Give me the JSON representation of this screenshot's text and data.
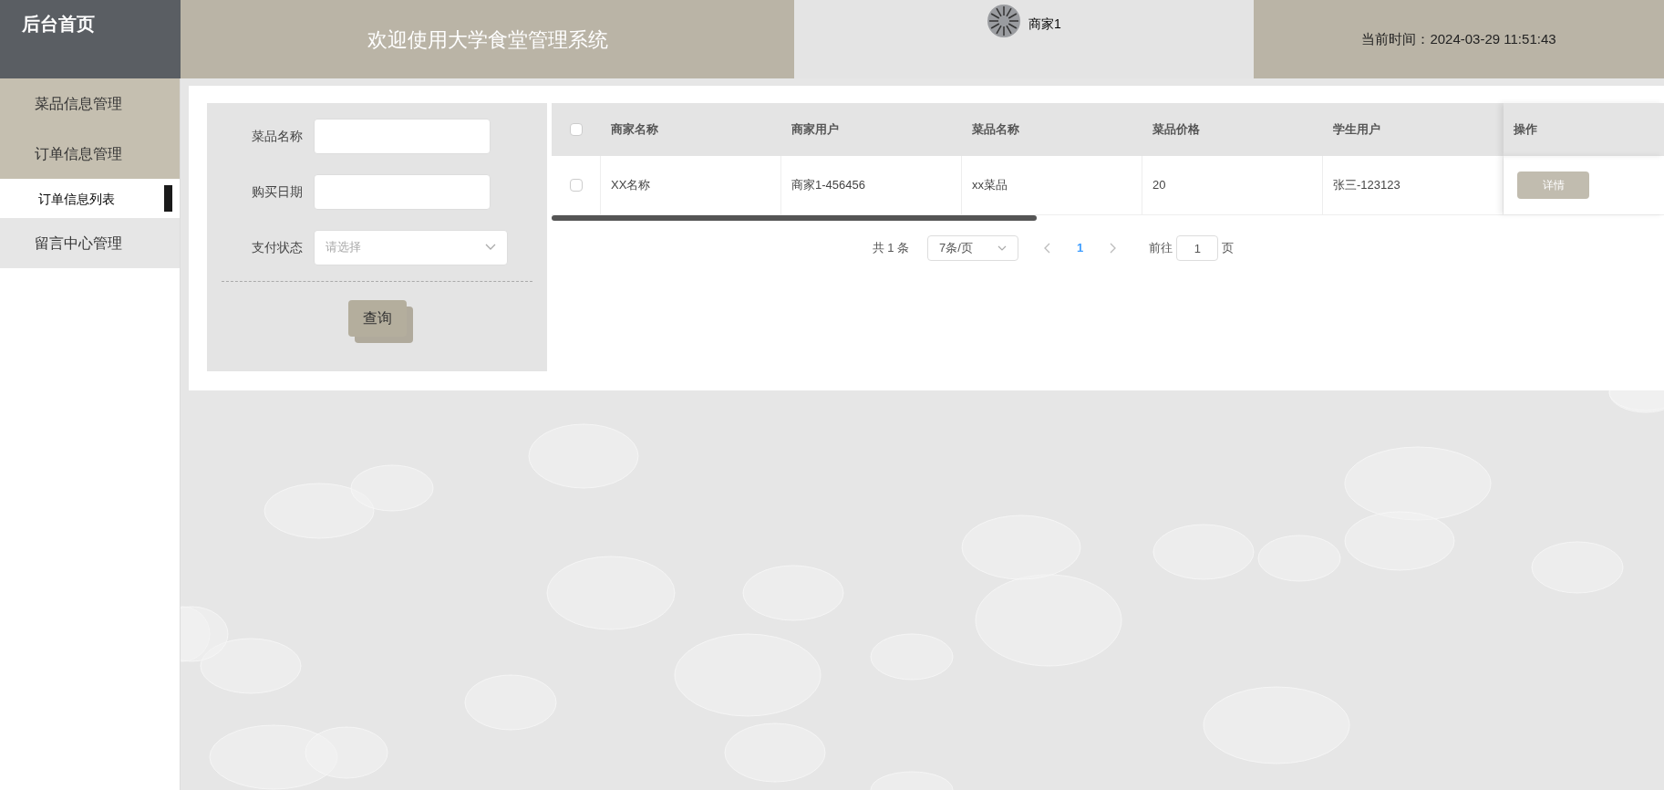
{
  "header": {
    "home": "后台首页",
    "title": "欢迎使用大学食堂管理系统",
    "user": "商家1",
    "time_label": "当前时间：",
    "time": "2024-03-29 11:51:43"
  },
  "sidebar": {
    "items": [
      {
        "label": "菜品信息管理",
        "highlighted": true
      },
      {
        "label": "订单信息管理",
        "highlighted": true,
        "children": [
          {
            "label": "订单信息列表",
            "selected": true
          }
        ]
      },
      {
        "label": "留言中心管理",
        "highlighted": false
      }
    ]
  },
  "search": {
    "fields": [
      {
        "kind": "text",
        "label": "菜品名称"
      },
      {
        "kind": "text",
        "label": "购买日期"
      },
      {
        "kind": "select",
        "label": "支付状态",
        "placeholder": "请选择"
      }
    ],
    "button": "查询"
  },
  "table": {
    "columns": [
      "商家名称",
      "商家用户",
      "菜品名称",
      "菜品价格",
      "学生用户",
      "操作"
    ],
    "all_checked": false,
    "rows": [
      {
        "checked": false,
        "cells": [
          "XX名称",
          "商家1-456456",
          "xx菜品",
          "20",
          "张三-123123"
        ],
        "action": "详情"
      }
    ]
  },
  "pagination": {
    "total": "共 1 条",
    "page_size": "7条/页",
    "pages": [
      {
        "label": "1",
        "selected": true
      }
    ],
    "goto_label": "前往",
    "goto_value": "1",
    "page_suffix": "页"
  }
}
